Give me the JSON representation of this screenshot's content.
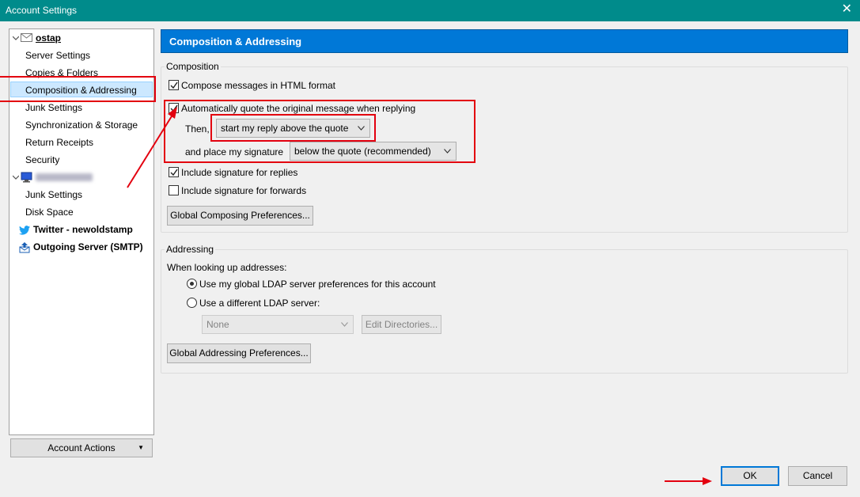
{
  "window": {
    "title": "Account Settings",
    "close_label": "✕"
  },
  "tree": {
    "account_name": "ostap",
    "items": [
      "Server Settings",
      "Copies & Folders",
      "Composition & Addressing",
      "Junk Settings",
      "Synchronization & Storage",
      "Return Receipts",
      "Security"
    ],
    "local_items": [
      "Junk Settings",
      "Disk Space"
    ],
    "twitter": "Twitter - newoldstamp",
    "outgoing": "Outgoing Server (SMTP)"
  },
  "account_actions": {
    "label": "Account Actions"
  },
  "header": {
    "title": "Composition & Addressing"
  },
  "composition": {
    "group_title": "Composition",
    "html_format": "Compose messages in HTML format",
    "auto_quote": "Automatically quote the original message when replying",
    "then_label": "Then,",
    "reply_position": "start my reply above the quote",
    "signature_label": "and place my signature",
    "signature_position": "below the quote (recommended)",
    "sig_replies": "Include signature for replies",
    "sig_forwards": "Include signature for forwards",
    "global_composing_btn": "Global Composing Preferences..."
  },
  "addressing": {
    "group_title": "Addressing",
    "lookup_label": "When looking up addresses:",
    "use_global": "Use my global LDAP server preferences for this account",
    "use_different": "Use a different LDAP server:",
    "ldap_select": "None",
    "edit_directories_btn": "Edit Directories...",
    "global_addressing_btn": "Global Addressing Preferences..."
  },
  "footer": {
    "ok": "OK",
    "cancel": "Cancel"
  },
  "colors": {
    "titlebar": "#008b8b",
    "banner": "#0078d7",
    "highlight": "#e3000f",
    "selection": "#cce8ff"
  }
}
